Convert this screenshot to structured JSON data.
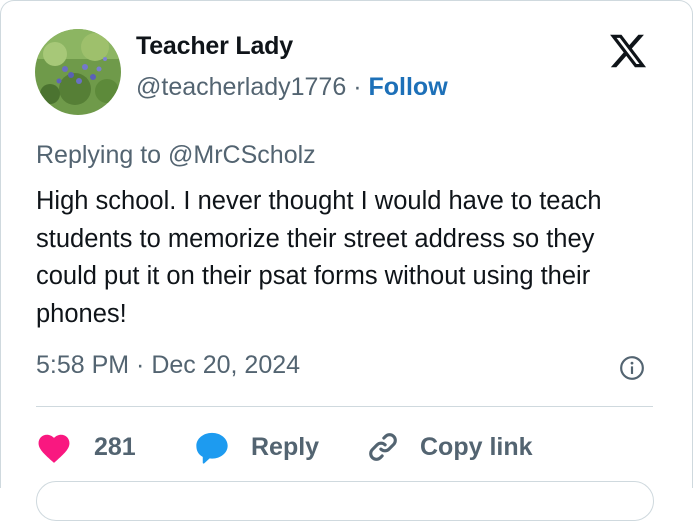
{
  "author": {
    "name": "Teacher Lady",
    "handle": "@teacherlady1776",
    "separator": "·",
    "follow_label": "Follow"
  },
  "tweet": {
    "replying_prefix": "Replying to",
    "replying_to": "@MrCScholz",
    "text": "High school. I never thought I would have to teach students to memorize their street address so they could put it on their psat forms without using their phones!",
    "timestamp": "5:58 PM · Dec 20, 2024"
  },
  "actions": {
    "like_count": "281",
    "reply_label": "Reply",
    "copy_link_label": "Copy link"
  },
  "colors": {
    "like": "#f91880",
    "reply_icon": "#1d9bf0",
    "follow": "#1d70b8",
    "muted": "#536471"
  },
  "icons": [
    "x-logo",
    "info-icon",
    "heart-icon",
    "reply-bubble-icon",
    "link-icon"
  ]
}
